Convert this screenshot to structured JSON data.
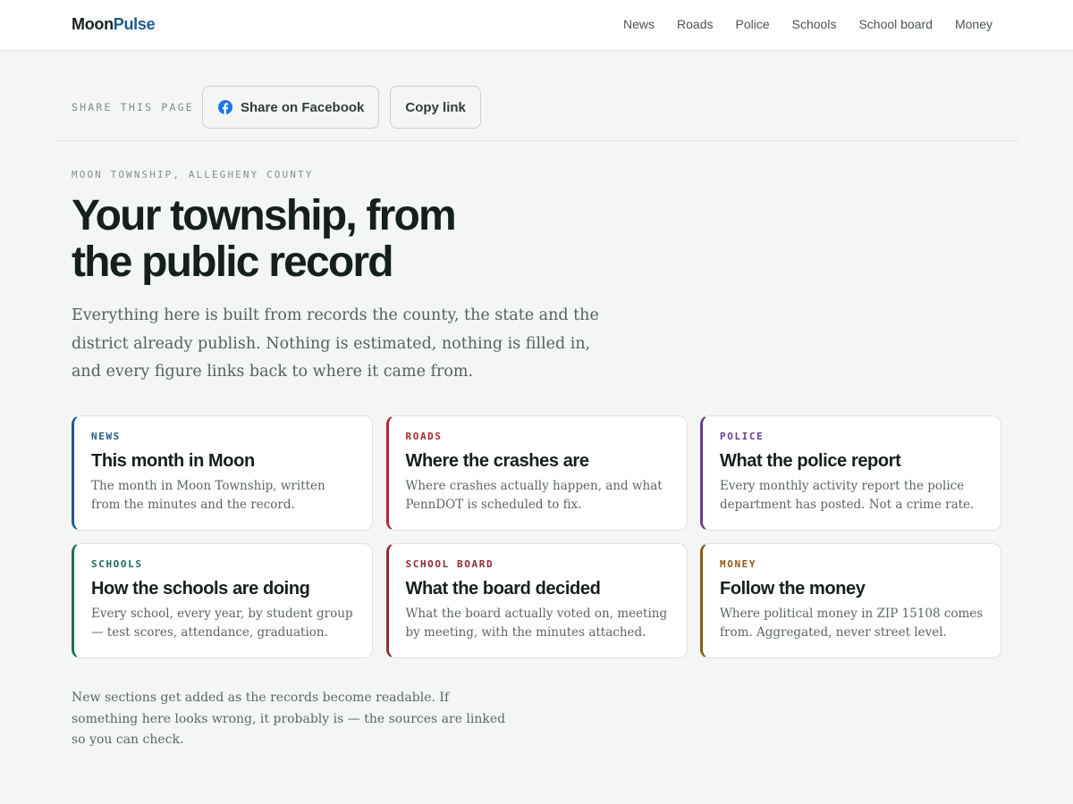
{
  "brand": {
    "part1": "Moon",
    "part2": "Pulse"
  },
  "nav": [
    {
      "label": "News"
    },
    {
      "label": "Roads"
    },
    {
      "label": "Police"
    },
    {
      "label": "Schools"
    },
    {
      "label": "School board"
    },
    {
      "label": "Money"
    }
  ],
  "share": {
    "label": "SHARE THIS PAGE",
    "facebook_label": "Share on Facebook",
    "copy_label": "Copy link",
    "facebook_icon": "facebook-icon",
    "facebook_color": "#1877f2"
  },
  "hero": {
    "eyebrow": "MOON TOWNSHIP, ALLEGHENY COUNTY",
    "title_line1": "Your township, from",
    "title_line2": "the public record",
    "lede": "Everything here is built from records the county, the state and the district already publish. Nothing is estimated, nothing is filled in, and every figure links back to where it came from."
  },
  "cards": [
    {
      "tag": "NEWS",
      "title": "This month in Moon",
      "desc": "The month in Moon Township, written from the minutes and the record.",
      "color": "#1f5b8c"
    },
    {
      "tag": "ROADS",
      "title": "Where the crashes are",
      "desc": "Where crashes actually happen, and what PennDOT is scheduled to fix.",
      "color": "#b3242f"
    },
    {
      "tag": "POLICE",
      "title": "What the police report",
      "desc": "Every monthly activity report the police department has posted. Not a crime rate.",
      "color": "#6a3d8f"
    },
    {
      "tag": "SCHOOLS",
      "title": "How the schools are doing",
      "desc": "Every school, every year, by student group — test scores, attendance, graduation.",
      "color": "#1f6b5c"
    },
    {
      "tag": "SCHOOL BOARD",
      "title": "What the board decided",
      "desc": "What the board actually voted on, meeting by meeting, with the minutes attached.",
      "color": "#8c2a34"
    },
    {
      "tag": "MONEY",
      "title": "Follow the money",
      "desc": "Where political money in ZIP 15108 comes from. Aggregated, never street level.",
      "color": "#8c5a12"
    }
  ],
  "footnote": "New sections get added as the records become readable. If something here looks wrong, it probably is — the sources are linked so you can check."
}
